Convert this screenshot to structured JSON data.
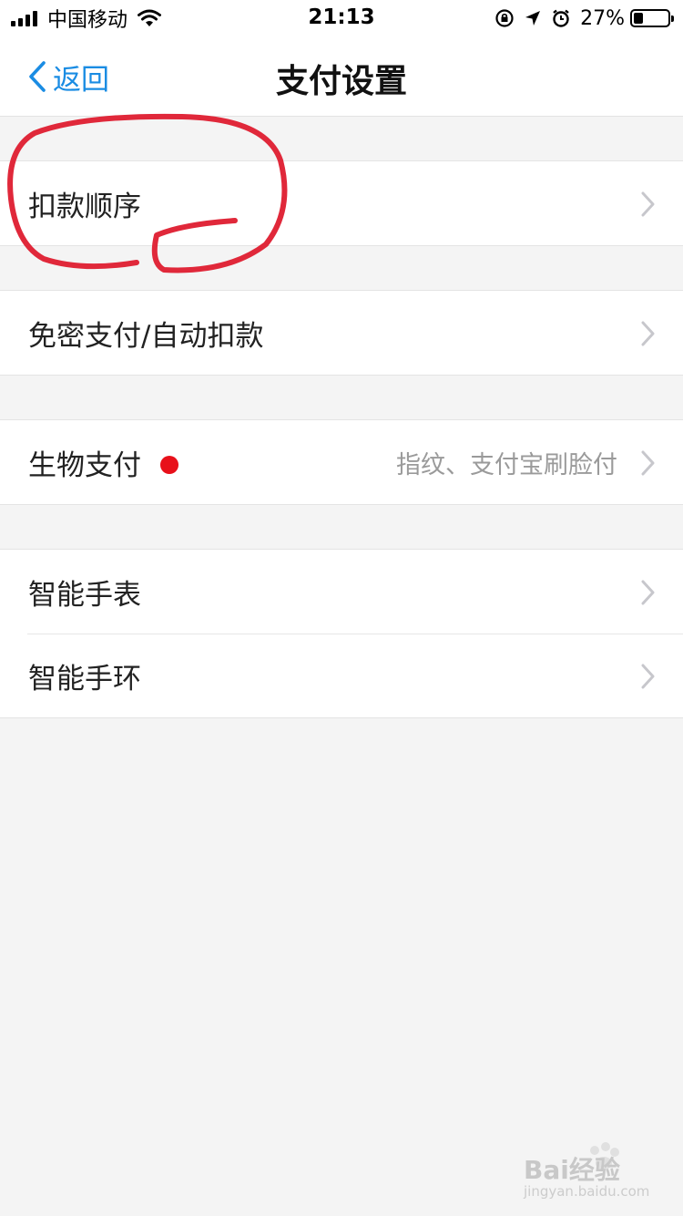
{
  "status_bar": {
    "carrier": "中国移动",
    "time": "21:13",
    "battery_percent": "27%",
    "battery_level": 0.27,
    "icons": [
      "signal-icon",
      "wifi-icon",
      "orientation-lock-icon",
      "location-icon",
      "alarm-icon",
      "battery-icon"
    ]
  },
  "nav": {
    "back_label": "返回",
    "title": "支付设置",
    "accent_color": "#1a8ce3"
  },
  "groups": [
    {
      "rows": [
        {
          "label": "扣款顺序"
        }
      ]
    },
    {
      "rows": [
        {
          "label": "免密支付/自动扣款"
        }
      ]
    },
    {
      "rows": [
        {
          "label": "生物支付",
          "detail": "指纹、支付宝刷脸付",
          "badge_color": "#e8101a"
        }
      ]
    },
    {
      "rows": [
        {
          "label": "智能手表"
        },
        {
          "label": "智能手环"
        }
      ]
    }
  ],
  "annotation": {
    "shape": "hand-drawn circle",
    "color": "#e0283a"
  },
  "watermark": {
    "text": "Bai经验",
    "sub": "jingyan.baidu.com"
  }
}
